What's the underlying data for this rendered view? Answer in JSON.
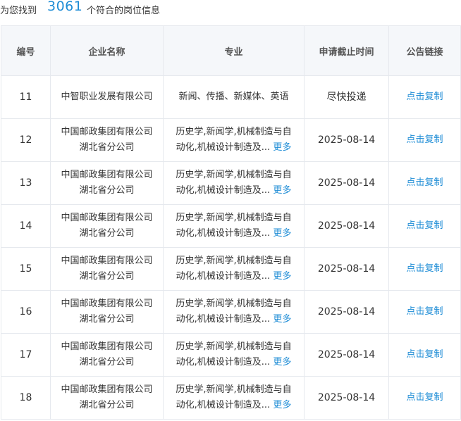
{
  "summary": {
    "prefix": "为您找到",
    "count": "3061",
    "suffix": "个符合的岗位信息"
  },
  "table": {
    "headers": {
      "index": "编号",
      "company": "企业名称",
      "major": "专业",
      "deadline": "申请截止时间",
      "link": "公告链接"
    },
    "rows": [
      {
        "index": "11",
        "company_line1": "中智职业发展有限公司",
        "company_line2": "",
        "major_line1": "新闻、传播、新媒体、英语",
        "major_line2": "",
        "more": "",
        "deadline": "尽快投递",
        "link": "点击复制"
      },
      {
        "index": "12",
        "company_line1": "中国邮政集团有限公司",
        "company_line2": "湖北省分公司",
        "major_line1": "历史学,新闻学,机械制造与自",
        "major_line2": "动化,机械设计制造及...",
        "more": "更多",
        "deadline": "2025-08-14",
        "link": "点击复制"
      },
      {
        "index": "13",
        "company_line1": "中国邮政集团有限公司",
        "company_line2": "湖北省分公司",
        "major_line1": "历史学,新闻学,机械制造与自",
        "major_line2": "动化,机械设计制造及...",
        "more": "更多",
        "deadline": "2025-08-14",
        "link": "点击复制"
      },
      {
        "index": "14",
        "company_line1": "中国邮政集团有限公司",
        "company_line2": "湖北省分公司",
        "major_line1": "历史学,新闻学,机械制造与自",
        "major_line2": "动化,机械设计制造及...",
        "more": "更多",
        "deadline": "2025-08-14",
        "link": "点击复制"
      },
      {
        "index": "15",
        "company_line1": "中国邮政集团有限公司",
        "company_line2": "湖北省分公司",
        "major_line1": "历史学,新闻学,机械制造与自",
        "major_line2": "动化,机械设计制造及...",
        "more": "更多",
        "deadline": "2025-08-14",
        "link": "点击复制"
      },
      {
        "index": "16",
        "company_line1": "中国邮政集团有限公司",
        "company_line2": "湖北省分公司",
        "major_line1": "历史学,新闻学,机械制造与自",
        "major_line2": "动化,机械设计制造及...",
        "more": "更多",
        "deadline": "2025-08-14",
        "link": "点击复制"
      },
      {
        "index": "17",
        "company_line1": "中国邮政集团有限公司",
        "company_line2": "湖北省分公司",
        "major_line1": "历史学,新闻学,机械制造与自",
        "major_line2": "动化,机械设计制造及...",
        "more": "更多",
        "deadline": "2025-08-14",
        "link": "点击复制"
      },
      {
        "index": "18",
        "company_line1": "中国邮政集团有限公司",
        "company_line2": "湖北省分公司",
        "major_line1": "历史学,新闻学,机械制造与自",
        "major_line2": "动化,机械设计制造及...",
        "more": "更多",
        "deadline": "2025-08-14",
        "link": "点击复制"
      }
    ]
  },
  "colors": {
    "accent": "#1f8dd6",
    "header_bg": "#f5f7fa",
    "border": "#e6e9ee",
    "text": "#333333"
  }
}
